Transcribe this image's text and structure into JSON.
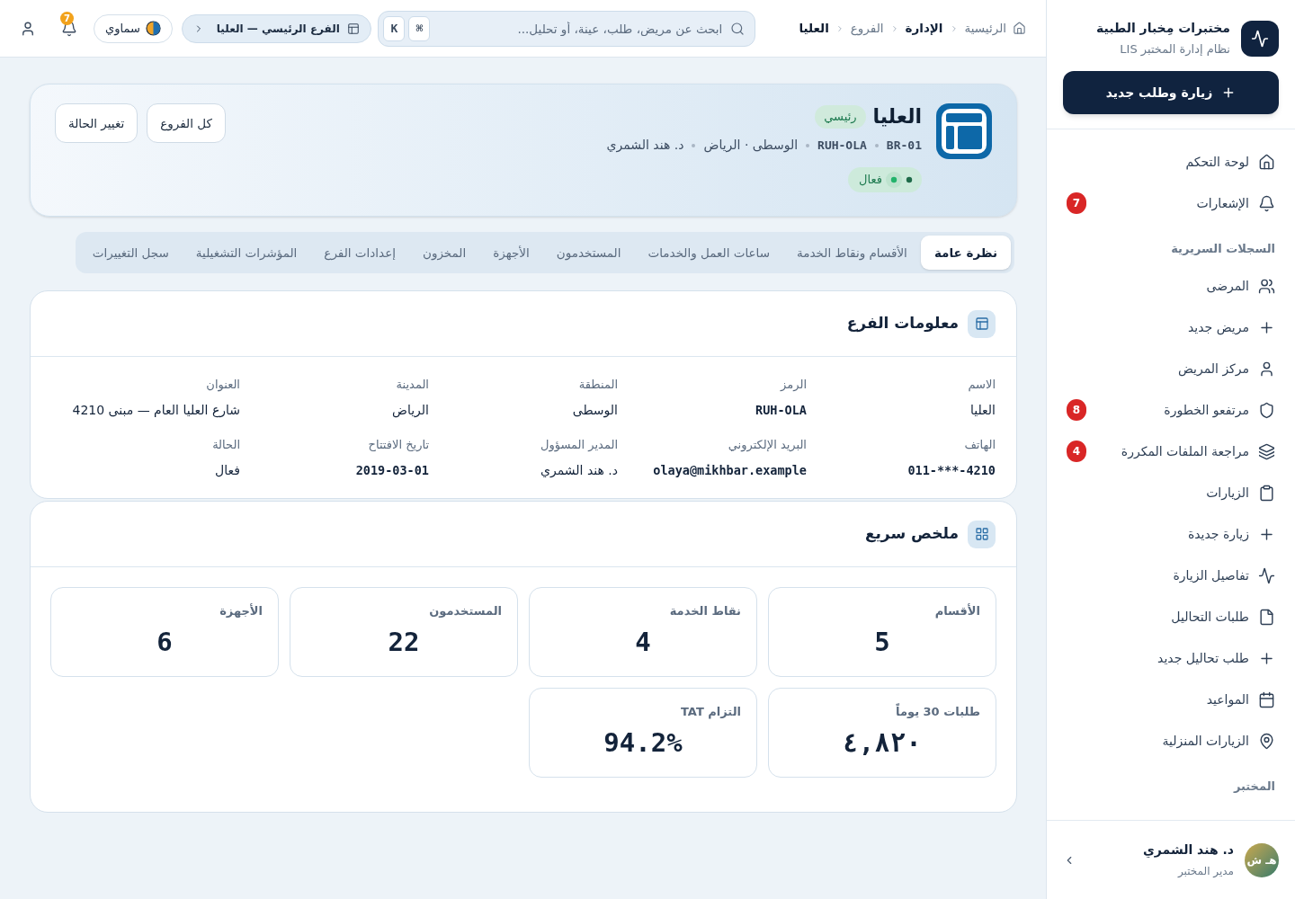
{
  "sidebar": {
    "brand": {
      "title": "مختبرات مِخبار الطبية",
      "subtitle": "نظام إدارة المختبر LIS"
    },
    "new_button": "زيارة وطلب جديد",
    "items": [
      {
        "kind": "link",
        "label": "لوحة التحكم",
        "selected": false
      },
      {
        "kind": "link",
        "label": "الإشعارات",
        "selected": false,
        "badge": "7"
      },
      {
        "kind": "heading",
        "label": "السجلات السريرية"
      },
      {
        "kind": "link",
        "label": "المرضى",
        "selected": false
      },
      {
        "kind": "link",
        "label": "مريض جديد",
        "selected": false
      },
      {
        "kind": "link",
        "label": "مركز المريض",
        "selected": false
      },
      {
        "kind": "link",
        "label": "مرتفعو الخطورة",
        "selected": false,
        "badge": "8"
      },
      {
        "kind": "link",
        "label": "مراجعة الملفات المكررة",
        "selected": false,
        "badge": "4"
      },
      {
        "kind": "link",
        "label": "الزيارات",
        "selected": false
      },
      {
        "kind": "link",
        "label": "زيارة جديدة",
        "selected": false
      },
      {
        "kind": "link",
        "label": "تفاصيل الزيارة",
        "selected": false
      },
      {
        "kind": "link",
        "label": "طلبات التحاليل",
        "selected": false
      },
      {
        "kind": "link",
        "label": "طلب تحاليل جديد",
        "selected": false
      },
      {
        "kind": "link",
        "label": "المواعيد",
        "selected": false
      },
      {
        "kind": "link",
        "label": "الزيارات المنزلية",
        "selected": false
      },
      {
        "kind": "heading",
        "label": "المختبر"
      }
    ],
    "user": {
      "name": "د. هند الشمري",
      "role": "مدير المختبر",
      "initials": "هـ ش"
    }
  },
  "header": {
    "breadcrumb": [
      {
        "label": "الرئيسية",
        "kind": "link"
      },
      {
        "label": "الإدارة",
        "kind": "section"
      },
      {
        "label": "الفروع",
        "kind": "link"
      },
      {
        "label": "العليا",
        "kind": "current"
      }
    ],
    "search": {
      "placeholder": "ابحث عن مريض، طلب، عينة، أو تحليل...",
      "shortcut": [
        "⌘",
        "K"
      ]
    },
    "branch_switcher": "الفرع الرئيسي — العليا",
    "theme": "سماوي",
    "notifications_badge": "7"
  },
  "branch": {
    "title": "العليا",
    "badge": "رئيسي",
    "meta": [
      {
        "text": "BR-01",
        "kind": "code"
      },
      {
        "text": "RUH-OLA",
        "kind": "code"
      },
      {
        "text": "الوسطى · الرياض",
        "kind": "text"
      },
      {
        "text": "د. هند الشمري",
        "kind": "text"
      }
    ],
    "status": {
      "label": "فعال",
      "kind": "active"
    },
    "actions": [
      "كل الفروع",
      "تغيير الحالة"
    ]
  },
  "tabs": [
    {
      "label": "نظرة عامة",
      "selected": true
    },
    {
      "label": "الأقسام ونقاط الخدمة",
      "selected": false
    },
    {
      "label": "ساعات العمل والخدمات",
      "selected": false
    },
    {
      "label": "المستخدمون",
      "selected": false
    },
    {
      "label": "الأجهزة",
      "selected": false
    },
    {
      "label": "المخزون",
      "selected": false
    },
    {
      "label": "إعدادات الفرع",
      "selected": false
    },
    {
      "label": "المؤشرات التشغيلية",
      "selected": false
    },
    {
      "label": "سجل التغييرات",
      "selected": false
    }
  ],
  "branch_info": {
    "title": "معلومات الفرع",
    "fields": [
      {
        "label": "الاسم",
        "value": "العليا",
        "kind": "text"
      },
      {
        "label": "الرمز",
        "value": "RUH-OLA",
        "kind": "code"
      },
      {
        "label": "المنطقة",
        "value": "الوسطى",
        "kind": "text"
      },
      {
        "label": "المدينة",
        "value": "الرياض",
        "kind": "text"
      },
      {
        "label": "العنوان",
        "value": "شارع العليا العام — مبنى 4210",
        "kind": "text"
      },
      {
        "label": "الهاتف",
        "value": "011-***-4210",
        "kind": "code"
      },
      {
        "label": "البريد الإلكتروني",
        "value": "olaya@mikhbar.example",
        "kind": "code"
      },
      {
        "label": "المدير المسؤول",
        "value": "د. هند الشمري",
        "kind": "text"
      },
      {
        "label": "تاريخ الافتتاح",
        "value": "2019-03-01",
        "kind": "code"
      },
      {
        "label": "الحالة",
        "value": "فعال",
        "kind": "text"
      }
    ]
  },
  "summary": {
    "title": "ملخص سريع",
    "stats": [
      {
        "label": "الأقسام",
        "value": "5"
      },
      {
        "label": "نقاط الخدمة",
        "value": "4"
      },
      {
        "label": "المستخدمون",
        "value": "22"
      },
      {
        "label": "الأجهزة",
        "value": "6"
      },
      {
        "label": "طلبات 30 يوماً",
        "value": "٤,٨٢٠"
      },
      {
        "label": "التزام TAT",
        "value": "94.2%"
      }
    ]
  }
}
